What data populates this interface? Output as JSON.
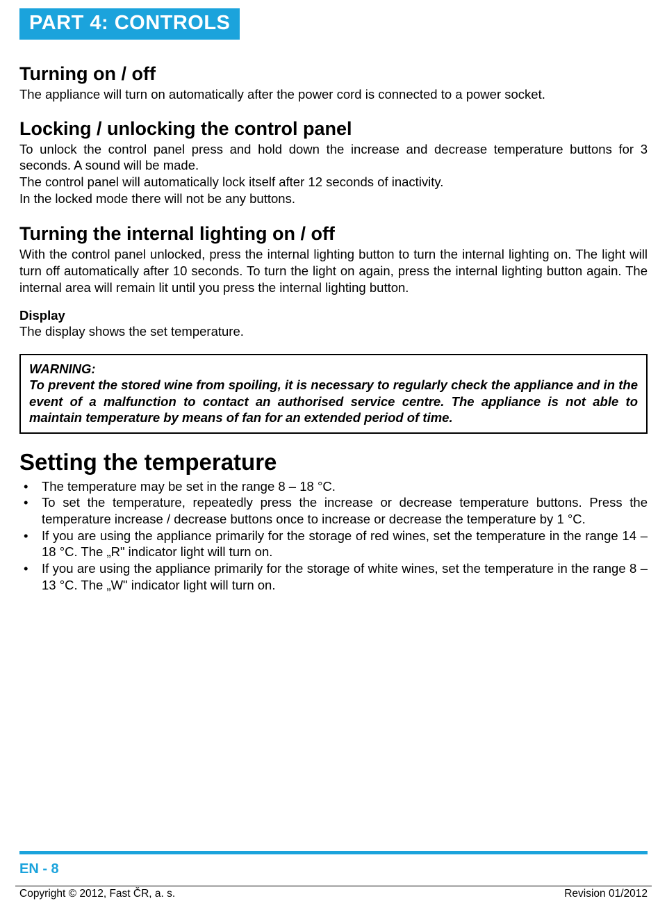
{
  "banner": "PART 4: CONTROLS",
  "sections": {
    "turning": {
      "heading": "Turning on / off",
      "body": "The appliance will turn on automatically after the power cord is connected to a power socket."
    },
    "locking": {
      "heading": "Locking / unlocking the control panel",
      "body1": "To unlock the control panel press and hold down the increase and decrease temperature buttons for 3 seconds. A sound will be made.",
      "body2": "The control panel will automatically lock itself after 12 seconds of inactivity.",
      "body3": "In the locked mode there will not be any buttons."
    },
    "lighting": {
      "heading": "Turning the internal lighting on / off",
      "body": "With the control panel unlocked, press the internal lighting button to turn the internal lighting on. The light will turn off automatically after 10 seconds. To turn the light on again, press the internal lighting button again. The internal area will remain lit until you press the internal lighting button."
    },
    "display": {
      "heading": "Display",
      "body": "The display shows the set temperature."
    },
    "warning": {
      "label": "WARNING:",
      "body": "To prevent the stored wine from spoiling, it is necessary to regularly check the appliance and in the event of a malfunction to contact an authorised service centre. The appliance is not able to maintain temperature by means of fan for an extended period of time."
    },
    "setting": {
      "heading": "Setting the temperature",
      "items": [
        "The temperature may be set in the range 8 – 18 °C.",
        "To set the temperature, repeatedly press the increase or decrease temperature buttons. Press the temperature increase / decrease buttons once to increase or decrease the temperature by 1 °C.",
        "If you are using the appliance primarily for the storage of red wines, set the temperature in the range 14 – 18 °C. The „R\" indicator light will turn on.",
        "If you are using the appliance primarily for the storage of white wines, set the temperature in the range 8 – 13 °C. The „W\" indicator light will turn on."
      ]
    }
  },
  "footer": {
    "page": "EN - 8",
    "copyright": "Copyright © 2012, Fast ČR, a. s.",
    "revision": "Revision 01/2012"
  }
}
